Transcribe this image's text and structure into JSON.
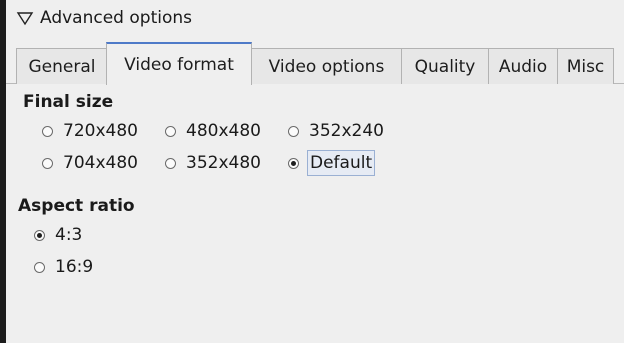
{
  "expander": {
    "label": "Advanced options"
  },
  "tabs": [
    {
      "label": "General"
    },
    {
      "label": "Video format"
    },
    {
      "label": "Video options"
    },
    {
      "label": "Quality"
    },
    {
      "label": "Audio"
    },
    {
      "label": "Misc"
    }
  ],
  "active_tab": "Video format",
  "final_size": {
    "heading": "Final size",
    "options": [
      "720x480",
      "480x480",
      "352x240",
      "704x480",
      "352x480",
      "Default"
    ],
    "selected": "Default"
  },
  "aspect_ratio": {
    "heading": "Aspect ratio",
    "options": [
      "4:3",
      "16:9"
    ],
    "selected": "4:3"
  },
  "icons": {
    "expander": "triangle-down-icon"
  },
  "colors": {
    "active_tab_accent": "#4e7ac8",
    "background": "#efefef"
  }
}
